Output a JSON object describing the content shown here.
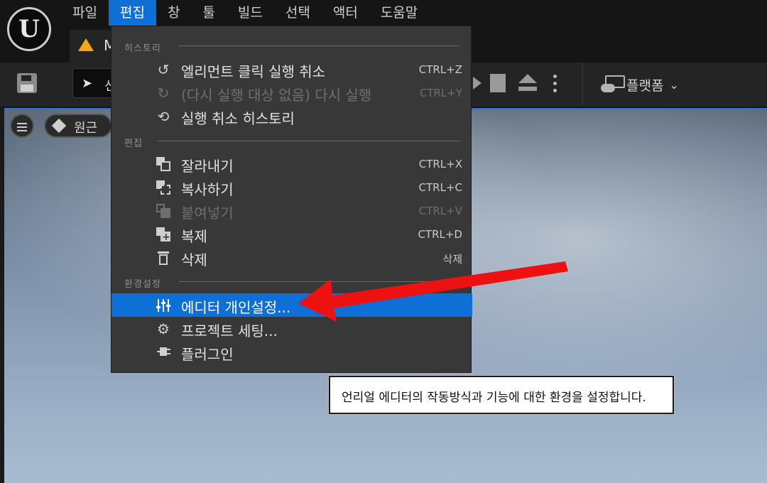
{
  "menubar": {
    "items": [
      "파일",
      "편집",
      "창",
      "툴",
      "빌드",
      "선택",
      "액터",
      "도움말"
    ],
    "active": "편집"
  },
  "level_tab": {
    "label": "M"
  },
  "toolbar": {
    "select_mode_label": "선",
    "platforms_label": "플랫폼"
  },
  "viewport": {
    "perspective_label": "원근"
  },
  "edit_menu": {
    "history_header": "히스토리",
    "undo": {
      "label": "엘리먼트 클릭 실행 취소",
      "shortcut": "CTRL+Z"
    },
    "redo": {
      "label": "(다시 실행 대상 없음) 다시 실행",
      "shortcut": "CTRL+Y",
      "disabled": true
    },
    "undo_history": {
      "label": "실행 취소 히스토리"
    },
    "edit_header": "편집",
    "cut": {
      "label": "잘라내기",
      "shortcut": "CTRL+X"
    },
    "copy": {
      "label": "복사하기",
      "shortcut": "CTRL+C"
    },
    "paste": {
      "label": "붙여넣기",
      "shortcut": "CTRL+V",
      "disabled": true
    },
    "duplicate": {
      "label": "복제",
      "shortcut": "CTRL+D"
    },
    "delete": {
      "label": "삭제",
      "shortcut": "삭제"
    },
    "settings_header": "환경설정",
    "editor_preferences": {
      "label": "에디터 개인설정...",
      "selected": true
    },
    "project_settings": {
      "label": "프로젝트 세팅..."
    },
    "plugins": {
      "label": "플러그인"
    }
  },
  "tooltip": {
    "text": "언리얼 에디터의 작동방식과 기능에 대한 환경을 설정합니다."
  },
  "colors": {
    "accent": "#0e6fd6",
    "menu_bg": "#383838",
    "annotation_arrow": "#ee1111"
  },
  "icons": [
    "unreal-logo",
    "level-icon",
    "save-icon",
    "select-mode-icon",
    "play-icon",
    "stop-icon",
    "eject-icon",
    "more-icon",
    "platforms-icon",
    "hamburger-icon",
    "perspective-icon",
    "undo-icon",
    "redo-icon",
    "undo-history-icon",
    "cut-icon",
    "copy-icon",
    "paste-icon",
    "duplicate-icon",
    "delete-icon",
    "sliders-icon",
    "project-settings-icon",
    "plugin-icon"
  ]
}
